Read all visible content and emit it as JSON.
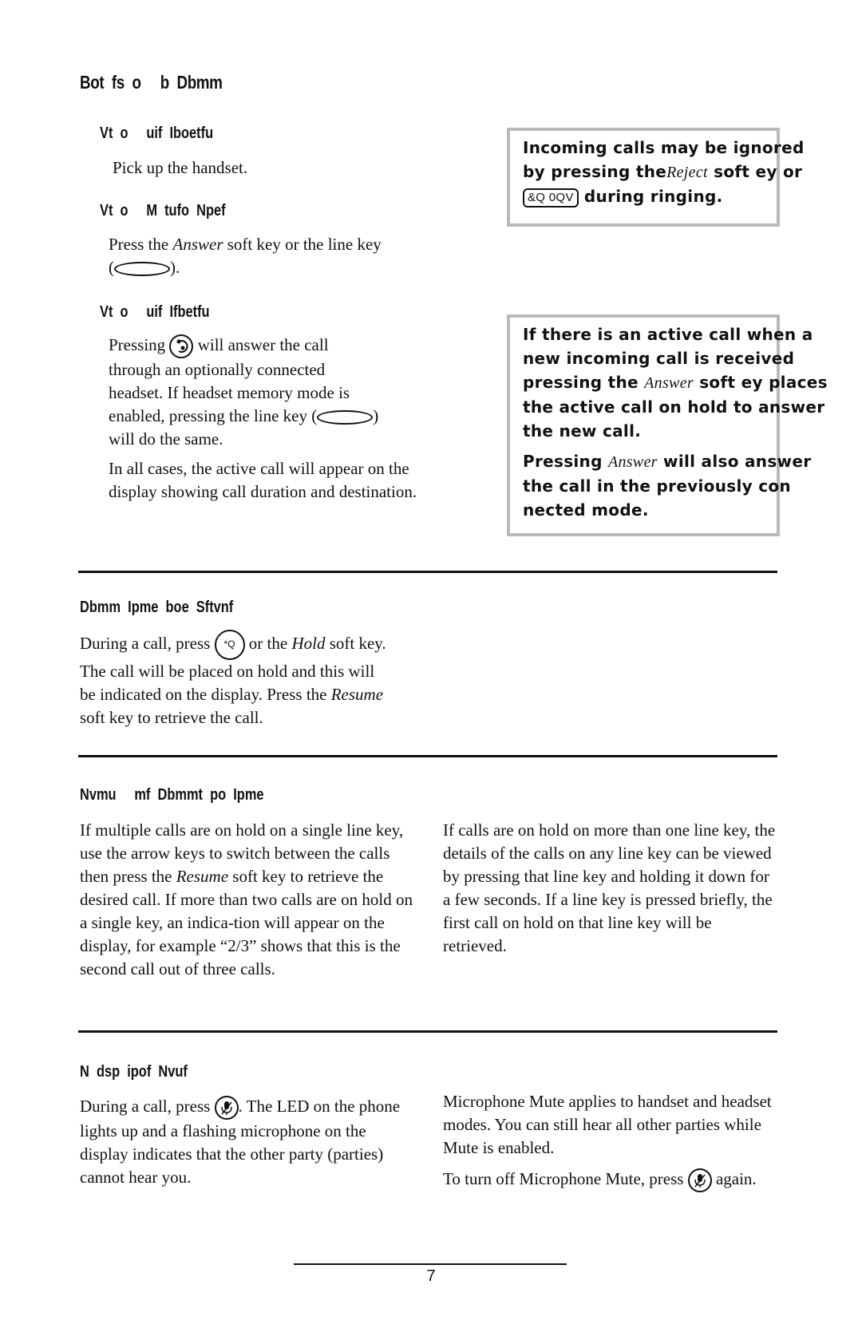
{
  "sections": {
    "answering": {
      "heading": "Bot  fs  o     b  Dbmm",
      "handset": {
        "heading": "Vt  o     uif  Iboetfu",
        "text": "Pick up the handset."
      },
      "line_mode": {
        "heading": "Vt  o     M  tufo  Npef",
        "text_before": "Press the ",
        "italic": "Answer",
        "text_after": " soft key or the line key",
        "line2_open": "(",
        "line2_close": ")."
      },
      "headset": {
        "heading": "Vt  o     uif  Ifbetfu",
        "p1_before": "Pressing ",
        "p1_after": " will answer the call",
        "p1_line2": "through an optionally connected",
        "p1_line3": "headset.  If headset memory mode is",
        "p1_line4_before": "enabled, pressing the line key (",
        "p1_line4_after": ")",
        "p1_line5": "will do the same.",
        "p2": "In all cases, the active call will appear on the display showing call duration and destination."
      },
      "callout1": {
        "line1": "Incoming calls may be ignored",
        "line2_before": "by pressing the",
        "line2_italic": "Reject",
        "line2_after": " soft   ey or",
        "key_label": "&Q 0QV",
        "line3_after": " during ringing."
      },
      "callout2": {
        "line1": "If there is an active call when a",
        "line2": "new incoming call is received",
        "line3_before": "pressing the ",
        "line3_italic": "Answer",
        "line3_after": " soft   ey places",
        "line4": "the active call on hold to answer",
        "line5": "the new call.",
        "line6_before": "Pressing ",
        "line6_italic": "Answer",
        "line6_after": " will also answer",
        "line7": "the call in the previously con",
        "line8": "nected mode."
      }
    },
    "hold": {
      "heading": "Dbmm  Ipme  boe  Sftvnf",
      "l1_before": "During a call, press ",
      "hold_icon_label": "*Q",
      "l1_mid": " or the ",
      "l1_italic": "Hold",
      "l1_after": " soft key.",
      "l2": "The call will be placed on hold and this will",
      "l3_before": "be indicated on the display.  Press the ",
      "l3_italic": "Resume",
      "l4": "soft key to retrieve the call."
    },
    "multiple_hold": {
      "heading": "Nvmu     mf  Dbmmt  po  Ipme",
      "left_before": "If multiple calls are on hold on a single line key, use the arrow keys to switch between the calls then press the ",
      "left_italic": "Resume",
      "left_after": " soft key to retrieve the desired call.  If more than two calls are on hold on a single key, an indica-tion will appear on the display, for example “2/3” shows that this is the second call out of three calls.",
      "right": "If calls are on hold on more than one line key, the details of the calls on any line key can be viewed by pressing that line key and holding it down for a few seconds.  If a line key is pressed briefly, the first call on hold on that line key will be retrieved."
    },
    "mute": {
      "heading": "N  dsp  ipof  Nvuf",
      "left_before": "During a call, press ",
      "left_after": ".  The LED on the phone lights up and a flashing microphone on the display indicates that the other party (parties) cannot hear you.",
      "right_p1": "Microphone Mute applies to handset and headset modes.  You can still hear all other parties while Mute is enabled.",
      "right_p2_before": "To turn off Microphone Mute, press ",
      "right_p2_after": " again."
    }
  },
  "footer": {
    "page_number": "7"
  }
}
